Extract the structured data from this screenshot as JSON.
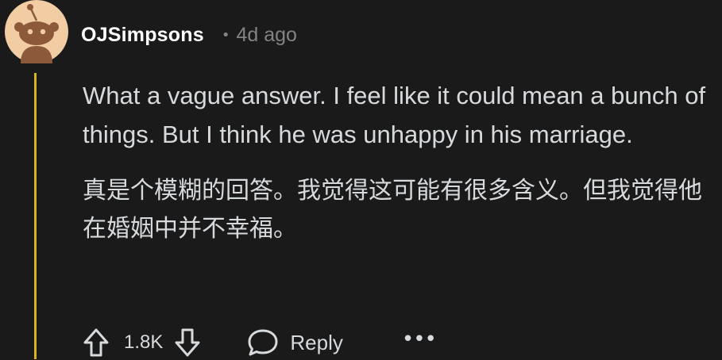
{
  "comment": {
    "username": "OJSimpsons",
    "separator": "•",
    "timestamp": "4d ago",
    "text_en": "What a vague answer. I feel like it could mean a bunch of things. But I think he was unhappy in his marriage.",
    "text_zh": "真是个模糊的回答。我觉得这可能有很多含义。但我觉得他在婚姻中并不幸福。",
    "score": "1.8K",
    "reply_label": "Reply",
    "more_label": "•••"
  },
  "colors": {
    "background": "#1a1a1b",
    "text": "#d7dadc",
    "muted": "#818384",
    "thread_line": "#d9b21f",
    "avatar_bg": "#f2cda3",
    "avatar_fg": "#8c5a3a"
  },
  "icons": {
    "avatar": "snoo-avatar-icon",
    "upvote": "upvote-arrow-icon",
    "downvote": "downvote-arrow-icon",
    "reply": "speech-bubble-icon",
    "more": "ellipsis-icon"
  }
}
